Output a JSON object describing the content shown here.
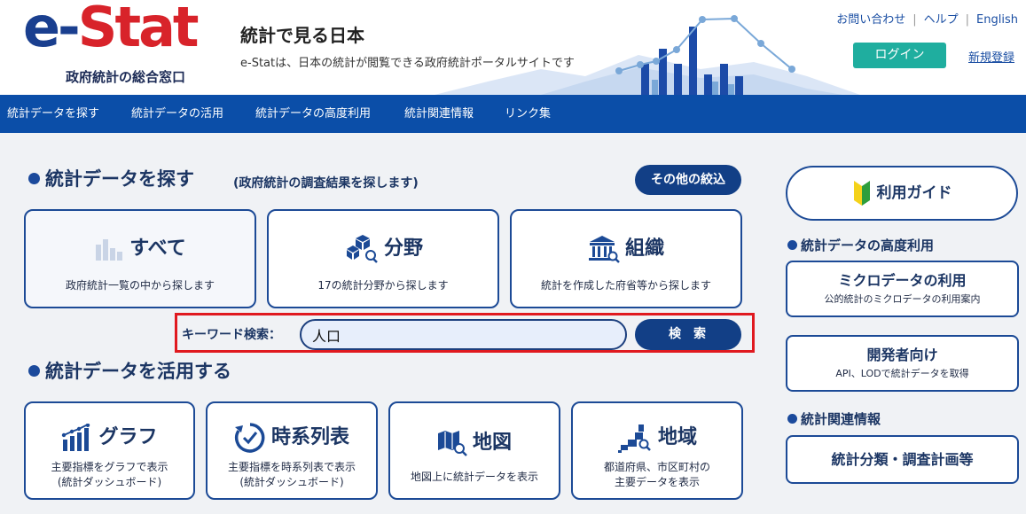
{
  "header": {
    "logo_text_1": "e-",
    "logo_text_2": "Stat",
    "logo_sub": "政府統計の総合窓口",
    "title": "統計で見る日本",
    "description": "e-Statは、日本の統計が閲覧できる政府統計ポータルサイトです",
    "links": [
      "お問い合わせ",
      "ヘルプ",
      "English"
    ],
    "link_separator": "|",
    "login": "ログイン",
    "register": "新規登録"
  },
  "nav": {
    "items": [
      "統計データを探す",
      "統計データの活用",
      "統計データの高度利用",
      "統計関連情報",
      "リンク集"
    ]
  },
  "search_section": {
    "title": "統計データを探す",
    "subtitle": "(政府統計の調査結果を探します)",
    "filter_button": "その他の絞込",
    "cards": [
      {
        "title": "すべて",
        "desc": "政府統計一覧の中から探します"
      },
      {
        "title": "分野",
        "desc": "17の統計分野から探します"
      },
      {
        "title": "組織",
        "desc": "統計を作成した府省等から探します"
      }
    ],
    "keyword_label": "キーワード検索：",
    "keyword_value": "人口",
    "search_button": "検索"
  },
  "use_section": {
    "title": "統計データを活用する",
    "cards": [
      {
        "title": "グラフ",
        "desc_1": "主要指標をグラフで表示",
        "desc_2": "(統計ダッシュボード)"
      },
      {
        "title": "時系列表",
        "desc_1": "主要指標を時系列表で表示",
        "desc_2": "(統計ダッシュボード)"
      },
      {
        "title": "地図",
        "desc_1": "地図上に統計データを表示",
        "desc_2": ""
      },
      {
        "title": "地域",
        "desc_1": "都道府県、市区町村の",
        "desc_2": "主要データを表示"
      }
    ]
  },
  "sidebar": {
    "guide": "利用ガイド",
    "advanced_heading": "統計データの高度利用",
    "micro_title": "ミクロデータの利用",
    "micro_desc": "公的統計のミクロデータの利用案内",
    "dev_title": "開発者向け",
    "dev_desc": "API、LODで統計データを取得",
    "related_heading": "統計関連情報",
    "classification": "統計分類・調査計画等"
  },
  "colors": {
    "nav_bg": "#0b4ea8",
    "login_bg": "#1fae9f",
    "primary_button": "#123f86",
    "card_border": "#1c4a96",
    "highlight": "#e0191f",
    "logo_red": "#d8232a",
    "logo_blue": "#1a3f8f"
  }
}
